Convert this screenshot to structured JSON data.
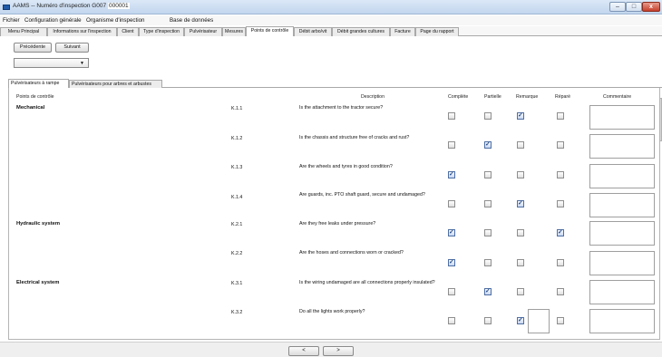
{
  "window": {
    "app_name": "AAMS",
    "separator": "--",
    "title_label": "Numéro d'inspection G007",
    "title_id": "000001"
  },
  "menu": [
    "Fichier",
    "Configuration générale",
    "Organisme d'inspection",
    "Base de données"
  ],
  "tabs": [
    {
      "label": "Menu Principal",
      "active": false
    },
    {
      "label": "Informations sur l'inspection",
      "active": false
    },
    {
      "label": "Client",
      "active": false
    },
    {
      "label": "Type d'inspection",
      "active": false
    },
    {
      "label": "Pulvérisateur",
      "active": false
    },
    {
      "label": "Mesures",
      "active": false
    },
    {
      "label": "Points de contrôle",
      "active": true
    },
    {
      "label": "Débit arbo/vit",
      "active": false
    },
    {
      "label": "Débit grandes cultures",
      "active": false
    },
    {
      "label": "Facture",
      "active": false
    },
    {
      "label": "Page du rapport",
      "active": false
    }
  ],
  "nav": {
    "prev_label": "Précédente",
    "next_label": "Suivant"
  },
  "dropdown": {
    "value": ""
  },
  "subtabs": [
    {
      "label": "Pulvérisateurs à rampe",
      "active": true
    },
    {
      "label": "Pulvérisateurs pour arbres et arbustes",
      "active": false
    }
  ],
  "headers": {
    "control_points": "Points de contrôle",
    "description": "Description",
    "complete": "Complète",
    "partial": "Partielle",
    "remark": "Remarque",
    "repaired": "Réparé",
    "comment": "Commentaire"
  },
  "rows": [
    {
      "section": "Mechanical",
      "code": "K.1.1",
      "description": "Is the attachment to the tractor secure?",
      "complete": false,
      "partial": false,
      "remark": true,
      "repaired": false
    },
    {
      "section": "",
      "code": "K.1.2",
      "description": "Is the chassis and structure free of cracks and rust?",
      "complete": false,
      "partial": true,
      "remark": false,
      "repaired": false
    },
    {
      "section": "",
      "code": "K.1.3",
      "description": "Are the wheels and tyres in good condition?",
      "complete": true,
      "partial": false,
      "remark": false,
      "repaired": false
    },
    {
      "section": "",
      "code": "K.1.4",
      "description": "Are guards, inc. PTO shaft guard, secure and undamaged?",
      "complete": false,
      "partial": false,
      "remark": true,
      "repaired": false
    },
    {
      "section": "Hydraulic system",
      "code": "K.2.1",
      "description": "Are they free leaks under pressure?",
      "complete": true,
      "partial": false,
      "remark": false,
      "repaired": true
    },
    {
      "section": "",
      "code": "K.2.2",
      "description": "Are the hoses and connections worn or cracked?",
      "complete": true,
      "partial": false,
      "remark": false,
      "repaired": false
    },
    {
      "section": "Electrical system",
      "code": "K.3.1",
      "description": "Is the wiring undamaged are all connections properly insulated?",
      "complete": false,
      "partial": true,
      "remark": false,
      "repaired": false
    },
    {
      "section": "",
      "code": "K.3.2",
      "description": "Do all the lights work properly?",
      "complete": false,
      "partial": false,
      "remark": true,
      "repaired": false
    }
  ],
  "pager": {
    "prev": "<",
    "next": ">"
  }
}
